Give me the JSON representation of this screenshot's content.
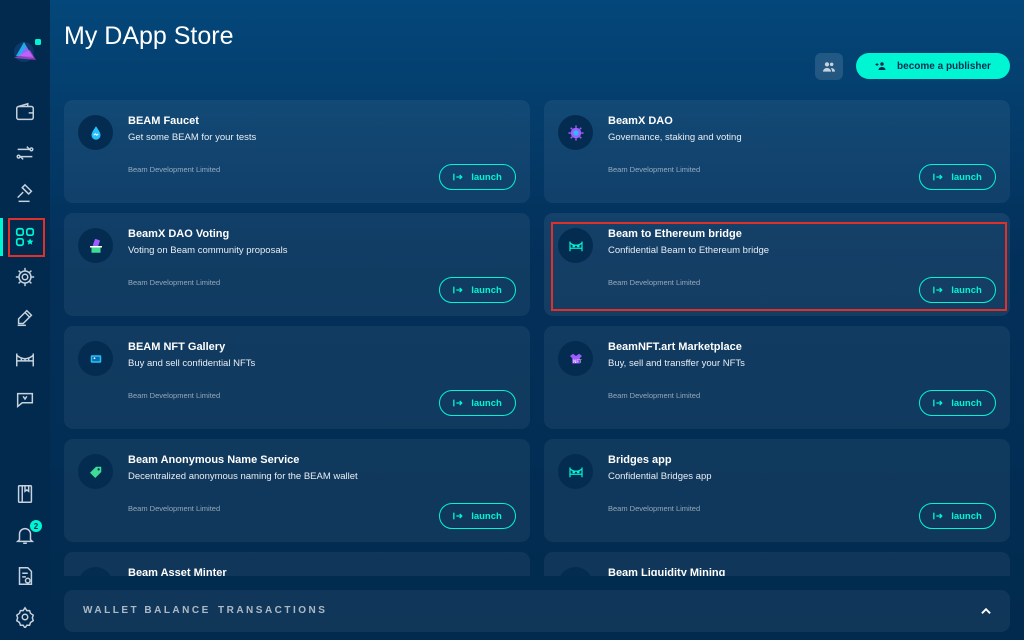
{
  "header": {
    "title": "My DApp Store",
    "publisher_button": "become a publisher"
  },
  "sidebar": {
    "notification_count": "2",
    "items": [
      {
        "icon": "wallet-icon"
      },
      {
        "icon": "swap-icon"
      },
      {
        "icon": "gavel-icon"
      },
      {
        "icon": "dapps-icon",
        "active": true
      },
      {
        "icon": "settings-gear-icon"
      },
      {
        "icon": "edit-icon"
      },
      {
        "icon": "bridge-icon"
      },
      {
        "icon": "chat-icon"
      },
      {
        "icon": "notebook-icon"
      },
      {
        "icon": "bell-icon"
      },
      {
        "icon": "document-icon"
      },
      {
        "icon": "gear-icon"
      }
    ]
  },
  "apps": [
    {
      "name": "BEAM Faucet",
      "desc": "Get some BEAM for your tests",
      "publisher": "Beam Development Limited",
      "launch": "launch",
      "icon": "water-drop-icon"
    },
    {
      "name": "BeamX DAO",
      "desc": "Governance, staking and voting",
      "publisher": "Beam Development Limited",
      "launch": "launch",
      "icon": "dao-icon"
    },
    {
      "name": "BeamX DAO Voting",
      "desc": "Voting on Beam community proposals",
      "publisher": "Beam Development Limited",
      "launch": "launch",
      "icon": "ballot-icon"
    },
    {
      "name": "Beam to Ethereum bridge",
      "desc": "Confidential Beam to Ethereum bridge",
      "publisher": "Beam Development Limited",
      "launch": "launch",
      "icon": "bridge-app-icon"
    },
    {
      "name": "BEAM NFT Gallery",
      "desc": "Buy and sell confidential NFTs",
      "publisher": "Beam Development Limited",
      "launch": "launch",
      "icon": "gallery-icon"
    },
    {
      "name": "BeamNFT.art Marketplace",
      "desc": "Buy, sell and transffer your NFTs",
      "publisher": "Beam Development Limited",
      "launch": "launch",
      "icon": "nft-icon"
    },
    {
      "name": "Beam Anonymous Name Service",
      "desc": "Decentralized anonymous naming for the BEAM wallet",
      "publisher": "Beam Development Limited",
      "launch": "launch",
      "icon": "tag-icon"
    },
    {
      "name": "Bridges app",
      "desc": "Confidential Bridges app",
      "publisher": "Beam Development Limited",
      "launch": "launch",
      "icon": "bridge-app-icon"
    },
    {
      "name": "Beam Asset Minter",
      "desc": "",
      "publisher": "",
      "launch": "",
      "icon": "minter-icon"
    },
    {
      "name": "Beam Liquidity Mining",
      "desc": "",
      "publisher": "",
      "launch": "",
      "icon": "mining-icon"
    }
  ],
  "bottom": {
    "wallet_balance": "WALLET BALANCE",
    "transactions": "TRANSACTIONS"
  },
  "colors": {
    "accent": "#00f6d2",
    "highlight": "#e0302a",
    "nft_purple": "#a05cff"
  }
}
